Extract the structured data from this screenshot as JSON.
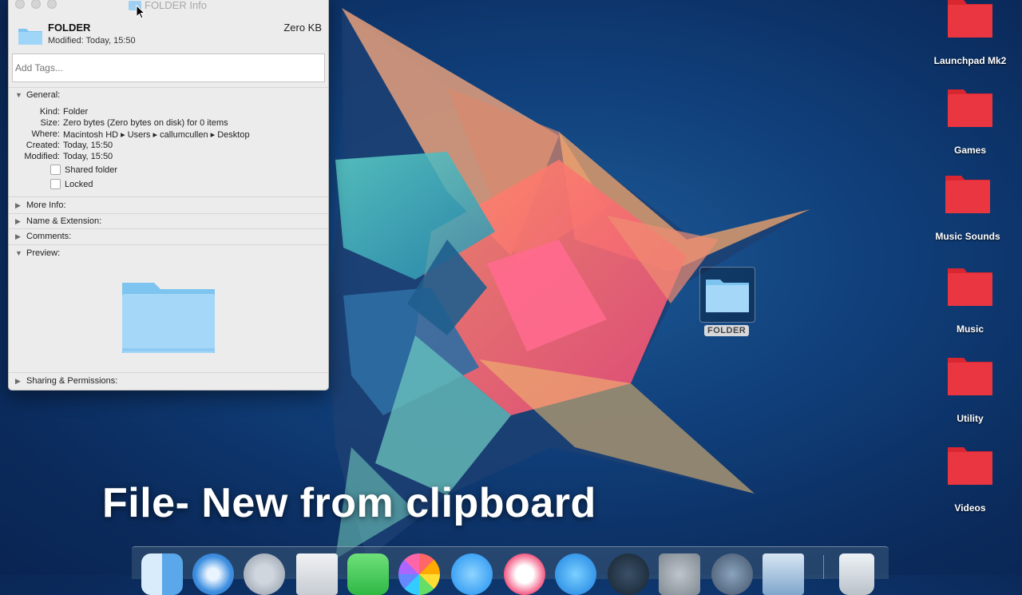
{
  "window": {
    "title": "FOLDER Info",
    "name": "FOLDER",
    "modified_header": "Modified: Today, 15:50",
    "size_header": "Zero KB",
    "tags_placeholder": "Add Tags...",
    "general": {
      "label": "General:",
      "rows": [
        {
          "key": "Kind:",
          "value": "Folder"
        },
        {
          "key": "Size:",
          "value": "Zero bytes (Zero bytes on disk) for 0 items"
        },
        {
          "key": "Where:",
          "value": "Macintosh HD ▸ Users ▸ callumcullen ▸ Desktop"
        },
        {
          "key": "Created:",
          "value": "Today, 15:50"
        },
        {
          "key": "Modified:",
          "value": "Today, 15:50"
        }
      ],
      "shared_label": "Shared folder",
      "locked_label": "Locked",
      "shared_checked": false,
      "locked_checked": false
    },
    "sections": {
      "more_info": "More Info:",
      "name_extension": "Name & Extension:",
      "comments": "Comments:",
      "preview": "Preview:",
      "sharing": "Sharing & Permissions:"
    }
  },
  "desktop": {
    "selected_item": "FOLDER",
    "items": [
      {
        "label": "Launchpad Mk2"
      },
      {
        "label": "Games"
      },
      {
        "label": "Music Sounds"
      },
      {
        "label": "Music"
      },
      {
        "label": "Utility"
      },
      {
        "label": "Videos"
      }
    ],
    "folder_color": "#e8303a",
    "caption": "File- New from clipboard"
  },
  "dock": {
    "icons": [
      "finder-icon",
      "safari-icon",
      "launchpad-icon",
      "mail-icon",
      "facetime-icon",
      "photos-icon",
      "messages-icon",
      "itunes-icon",
      "app-store-icon",
      "steam-icon",
      "system-preferences-icon",
      "quicktime-icon",
      "preview-icon",
      "trash-icon"
    ]
  }
}
